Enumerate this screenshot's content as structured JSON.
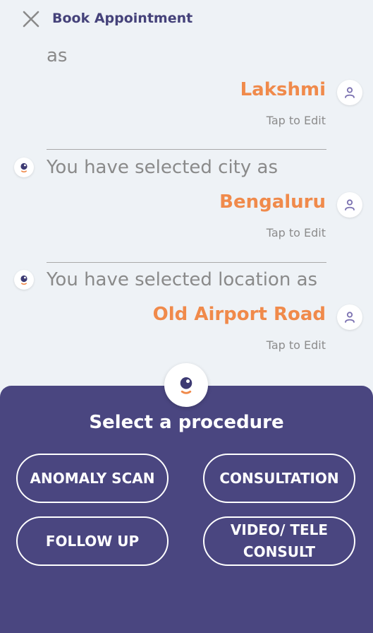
{
  "header": {
    "title": "Book Appointment"
  },
  "chat": {
    "prev_suffix": "as",
    "name_answer": "Lakshmi",
    "tap_to_edit": "Tap to Edit",
    "city_question": "You have selected city  as",
    "city_answer": "Bengaluru",
    "location_question": "You have selected location as",
    "location_answer": "Old Airport Road"
  },
  "procedure_panel": {
    "title": "Select a procedure",
    "options": [
      "ANOMALY SCAN",
      "CONSULTATION",
      "FOLLOW UP",
      "VIDEO/ TELE\nCONSULT"
    ]
  },
  "colors": {
    "accent": "#f08a4b",
    "panel": "#4a4680",
    "header_text": "#45427a"
  }
}
